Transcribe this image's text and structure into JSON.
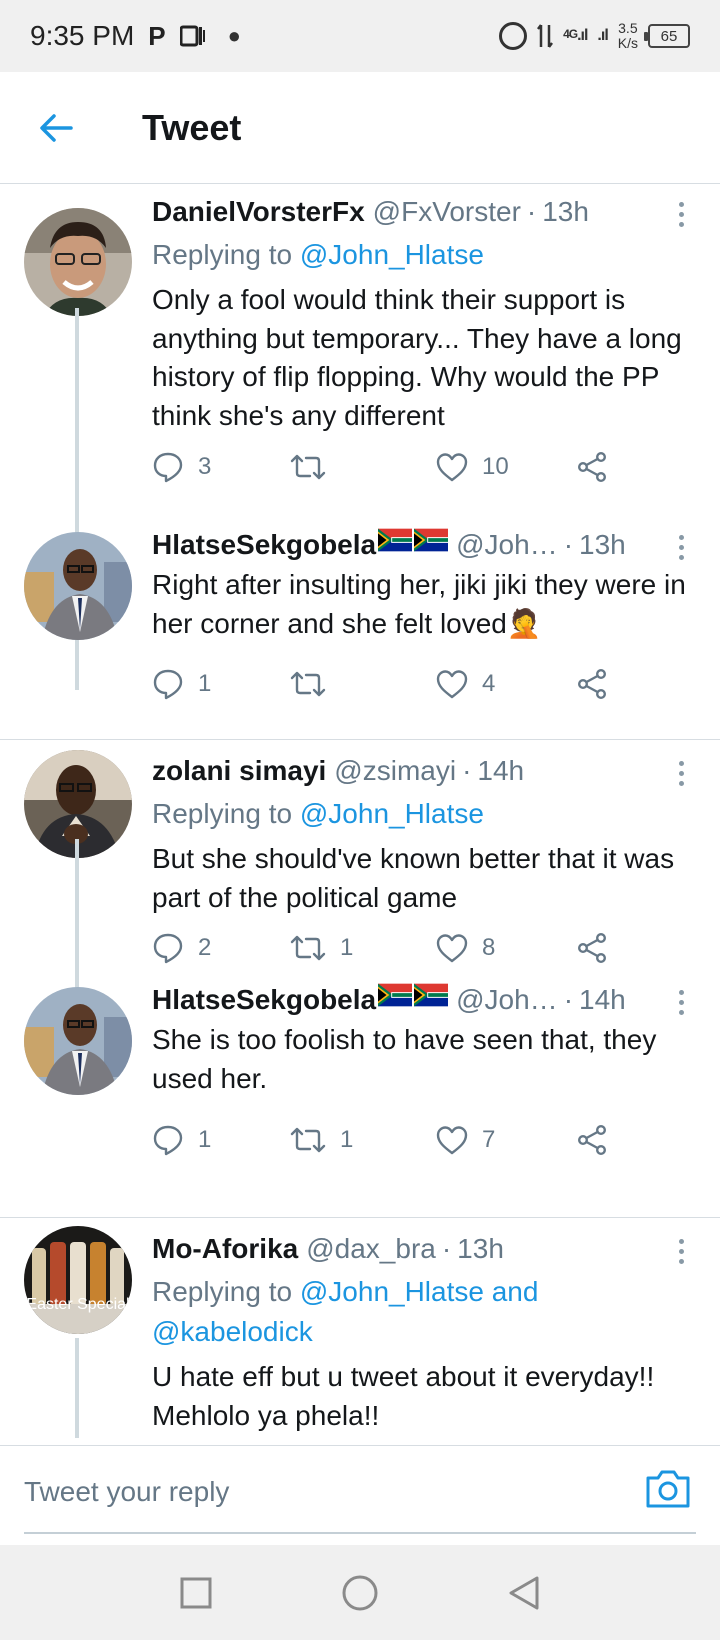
{
  "status_bar": {
    "time": "9:35 PM",
    "icon1": "P",
    "network": "4G",
    "speed_value": "3.5",
    "speed_unit": "K/s",
    "battery": "65"
  },
  "header": {
    "title": "Tweet",
    "back_icon": "back-arrow-icon"
  },
  "colors": {
    "accent": "#1b95e0",
    "secondary_text": "#657786",
    "divider": "#d7dde2",
    "icon": "#657786"
  },
  "tweets": [
    {
      "name": "DanielVorsterFx",
      "handle": "@FxVorster",
      "time": "13h",
      "replying_prefix": "Replying to ",
      "replying_to": "@John_Hlatse",
      "text": "Only a fool would think their support is anything but temporary... They have a long history of flip flopping. Why would the PP think she's any different",
      "replies": "3",
      "retweets": "",
      "likes": "10"
    },
    {
      "name": "HlatseSekgobela",
      "handle": "@Joh…",
      "time": "13h",
      "text": "Right after insulting her,  jiki jiki they were in her corner and she felt loved",
      "emoji": "🤦",
      "replies": "1",
      "retweets": "",
      "likes": "4"
    },
    {
      "name": "zolani simayi",
      "handle": "@zsimayi",
      "time": "14h",
      "replying_prefix": "Replying to ",
      "replying_to": "@John_Hlatse",
      "text": "But she should've known better that it was part of the political game",
      "replies": "2",
      "retweets": "1",
      "likes": "8"
    },
    {
      "name": "HlatseSekgobela",
      "handle": "@Joh…",
      "time": "14h",
      "text": "She is too foolish to have seen that,  they used her.",
      "replies": "1",
      "retweets": "1",
      "likes": "7"
    },
    {
      "name": "Mo-Aforika",
      "handle": "@dax_bra",
      "time": "13h",
      "replying_prefix": "Replying to ",
      "replying_to": "@John_Hlatse and @kabelodick",
      "text": "U hate eff but u tweet about it everyday!! Mehlolo ya phela!!",
      "avatar_text": "Easter Special"
    }
  ],
  "reply_bar": {
    "placeholder": "Tweet your reply",
    "camera_icon": "camera-icon"
  },
  "nav": {
    "recent_icon": "square-icon",
    "home_icon": "circle-icon",
    "back_icon": "triangle-back-icon"
  }
}
